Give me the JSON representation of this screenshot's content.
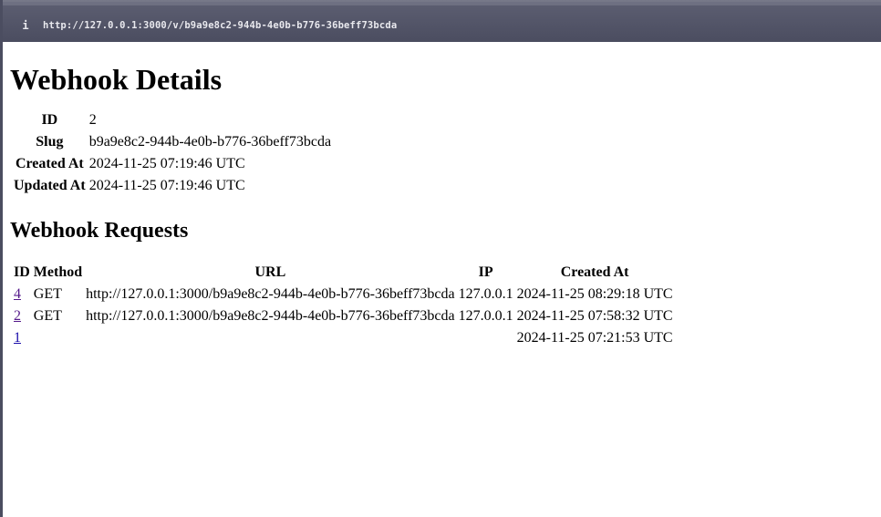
{
  "browser": {
    "info_icon": "i",
    "url": "http://127.0.0.1:3000/v/b9a9e8c2-944b-4e0b-b776-36beff73bcda"
  },
  "page": {
    "title": "Webhook Details",
    "details": [
      {
        "label": "ID",
        "value": "2"
      },
      {
        "label": "Slug",
        "value": "b9a9e8c2-944b-4e0b-b776-36beff73bcda"
      },
      {
        "label": "Created At",
        "value": "2024-11-25 07:19:46 UTC"
      },
      {
        "label": "Updated At",
        "value": "2024-11-25 07:19:46 UTC"
      }
    ],
    "requests_title": "Webhook Requests",
    "requests_columns": {
      "id": "ID",
      "method": "Method",
      "url": "URL",
      "ip": "IP",
      "created_at": "Created At"
    },
    "requests": [
      {
        "id": "4",
        "method": "GET",
        "url": "http://127.0.0.1:3000/b9a9e8c2-944b-4e0b-b776-36beff73bcda",
        "ip": "127.0.0.1",
        "created_at": "2024-11-25 08:29:18 UTC"
      },
      {
        "id": "2",
        "method": "GET",
        "url": "http://127.0.0.1:3000/b9a9e8c2-944b-4e0b-b776-36beff73bcda",
        "ip": "127.0.0.1",
        "created_at": "2024-11-25 07:58:32 UTC"
      },
      {
        "id": "1",
        "method": "",
        "url": "",
        "ip": "",
        "created_at": "2024-11-25 07:21:53 UTC"
      }
    ]
  },
  "colors": {
    "browser_bar": "#4b4d60",
    "link": "#1a0dab",
    "visited_link": "#551a8b"
  }
}
